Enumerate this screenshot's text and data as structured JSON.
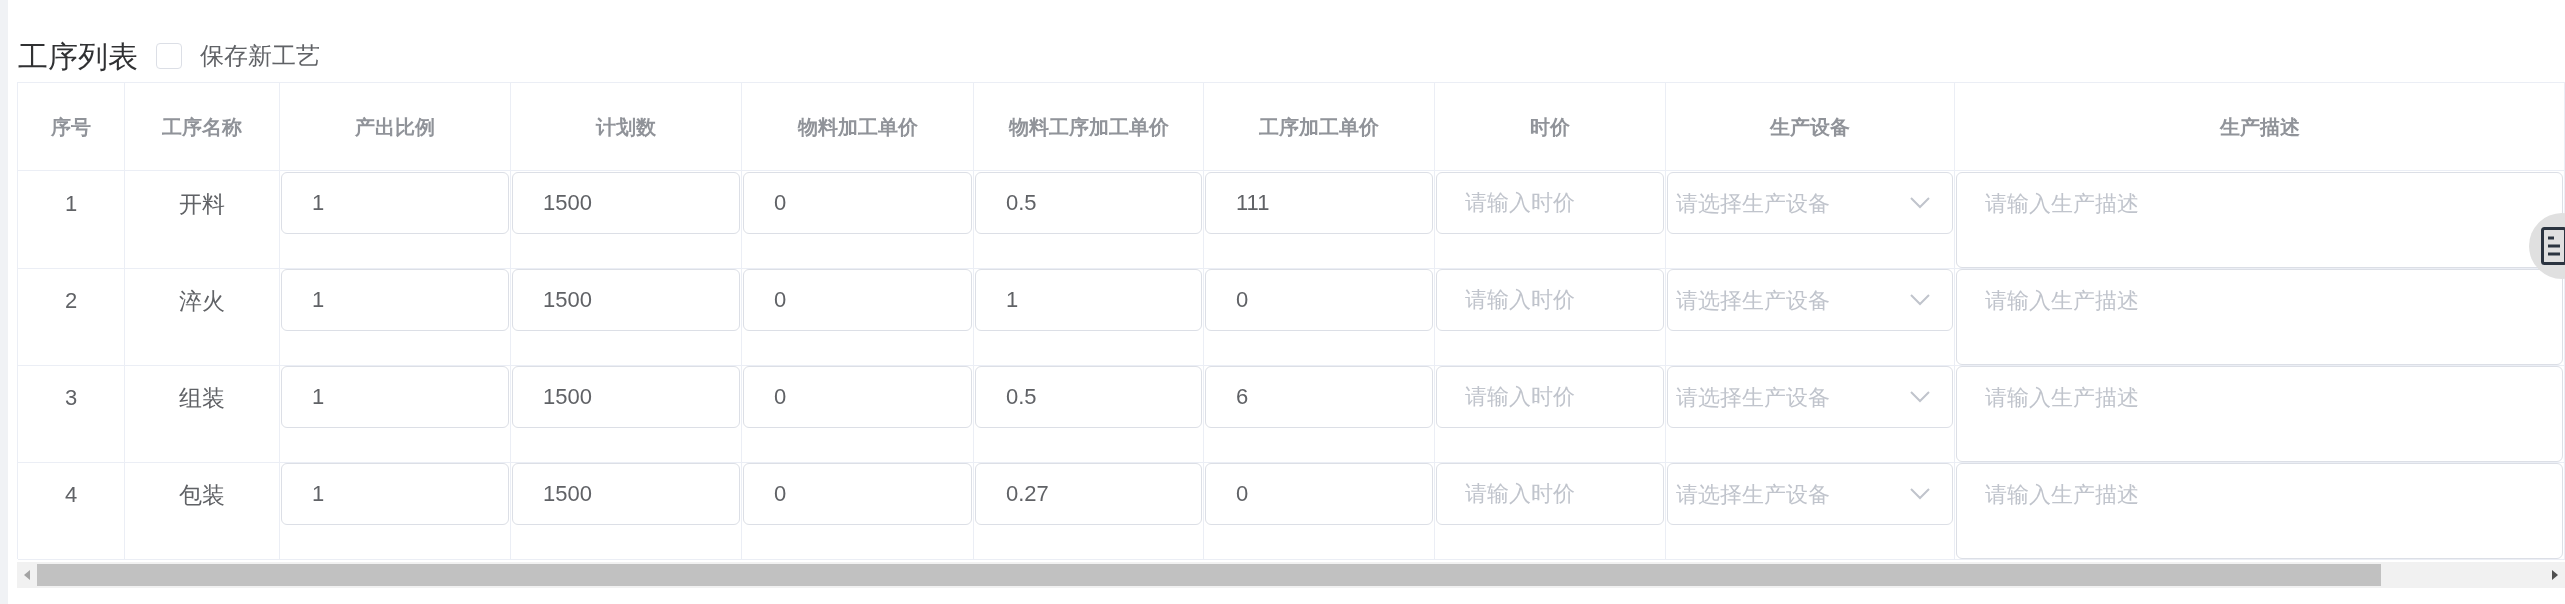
{
  "title": "工序列表",
  "save_new_process": {
    "label": "保存新工艺",
    "checked": false
  },
  "columns": [
    "序号",
    "工序名称",
    "产出比例",
    "计划数",
    "物料加工单价",
    "物料工序加工单价",
    "工序加工单价",
    "时价",
    "生产设备",
    "生产描述"
  ],
  "rows": [
    {
      "index": "1",
      "name": "开料",
      "output_ratio": "1",
      "plan_qty": "1500",
      "material_unit_price": "0",
      "material_process_unit_price": "0.5",
      "process_unit_price": "111",
      "hourly_price": {
        "placeholder": "请输入时价"
      },
      "equipment": {
        "placeholder": "请选择生产设备"
      },
      "description": {
        "placeholder": "请输入生产描述"
      }
    },
    {
      "index": "2",
      "name": "淬火",
      "output_ratio": "1",
      "plan_qty": "1500",
      "material_unit_price": "0",
      "material_process_unit_price": "1",
      "process_unit_price": "0",
      "hourly_price": {
        "placeholder": "请输入时价"
      },
      "equipment": {
        "placeholder": "请选择生产设备"
      },
      "description": {
        "placeholder": "请输入生产描述"
      }
    },
    {
      "index": "3",
      "name": "组装",
      "output_ratio": "1",
      "plan_qty": "1500",
      "material_unit_price": "0",
      "material_process_unit_price": "0.5",
      "process_unit_price": "6",
      "hourly_price": {
        "placeholder": "请输入时价"
      },
      "equipment": {
        "placeholder": "请选择生产设备"
      },
      "description": {
        "placeholder": "请输入生产描述"
      }
    },
    {
      "index": "4",
      "name": "包装",
      "output_ratio": "1",
      "plan_qty": "1500",
      "material_unit_price": "0",
      "material_process_unit_price": "0.27",
      "process_unit_price": "0",
      "hourly_price": {
        "placeholder": "请输入时价"
      },
      "equipment": {
        "placeholder": "请选择生产设备"
      },
      "description": {
        "placeholder": "请输入生产描述"
      }
    }
  ]
}
